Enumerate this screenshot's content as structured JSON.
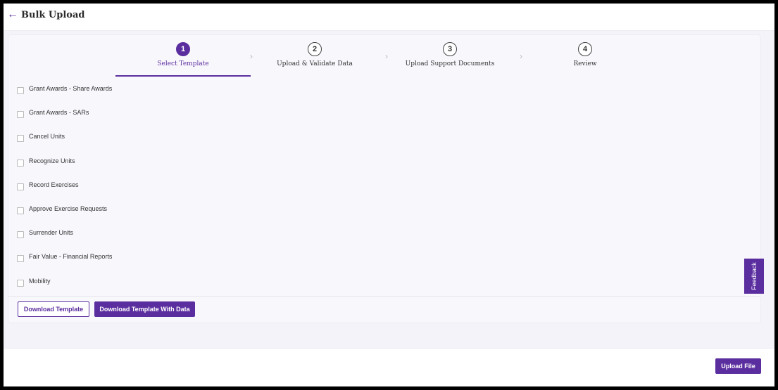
{
  "header": {
    "title": "Bulk Upload",
    "back_icon": "arrow-left-icon"
  },
  "steps": [
    {
      "number": "1",
      "label": "Select Template"
    },
    {
      "number": "2",
      "label": "Upload & Validate Data"
    },
    {
      "number": "3",
      "label": "Upload Support Documents"
    },
    {
      "number": "4",
      "label": "Review"
    }
  ],
  "templates": [
    "Grant Awards - Share Awards",
    "Grant Awards - SARs",
    "Cancel Units",
    "Recognize Units",
    "Record Exercises",
    "Approve Exercise Requests",
    "Surrender Units",
    "Fair Value - Financial Reports",
    "Mobility"
  ],
  "buttons": {
    "download_template": "Download Template",
    "download_template_with_data": "Download Template With Data",
    "upload_file": "Upload File"
  },
  "feedback": {
    "label": "Feedback"
  },
  "colors": {
    "accent": "#5b2e9f",
    "background": "#f4f3f9"
  }
}
